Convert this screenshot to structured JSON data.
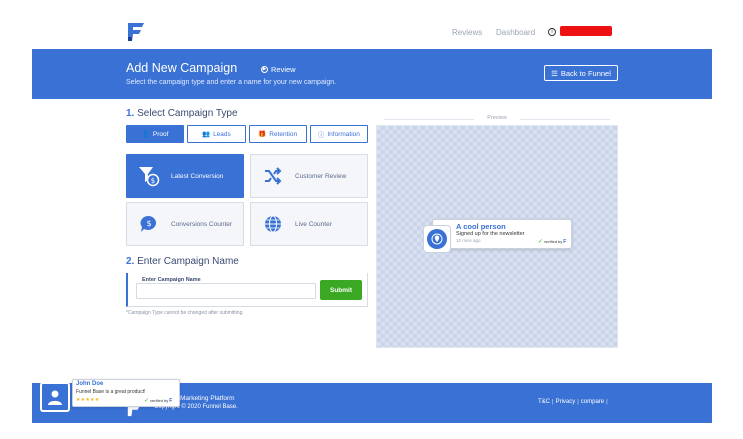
{
  "nav": {
    "reviews": "Reviews",
    "dashboard": "Dashboard",
    "info_icon": "info-icon"
  },
  "banner": {
    "title": "Add New Campaign",
    "review_label": "Review",
    "subtitle": "Select the campaign type and enter a name for your new campaign.",
    "back_button": "Back to Funnel"
  },
  "section1": {
    "num": "1.",
    "title": "Select Campaign Type"
  },
  "tabs": [
    {
      "label": "Proof",
      "icon": "user-plus-icon",
      "active": true
    },
    {
      "label": "Leads",
      "icon": "users-icon",
      "active": false
    },
    {
      "label": "Retention",
      "icon": "gift-icon",
      "active": false
    },
    {
      "label": "Information",
      "icon": "info-icon",
      "active": false
    }
  ],
  "types": [
    {
      "label": "Latest Conversion",
      "icon": "funnel-dollar-icon",
      "active": true
    },
    {
      "label": "Customer Review",
      "icon": "shuffle-icon",
      "active": false
    },
    {
      "label": "Conversions Counter",
      "icon": "dollar-bubble-icon",
      "active": false
    },
    {
      "label": "Live Counter",
      "icon": "globe-icon",
      "active": false
    }
  ],
  "section2": {
    "num": "2.",
    "title": "Enter Campaign Name"
  },
  "name_form": {
    "label": "Enter Campaign Name",
    "value": "",
    "submit": "Submit",
    "note": "*Campaign Type cannot be changed after submitting."
  },
  "preview": {
    "label": "Preview",
    "notification": {
      "name": "A cool person",
      "message": "Signed up for the newsletter",
      "time": "10 mins ago",
      "verified": "verified by"
    }
  },
  "footer": {
    "line1": "Marketing Platform",
    "line2": "Copyright © 2020 Funnel Base.",
    "links": [
      "T&C",
      "Privacy",
      "compare"
    ]
  },
  "popup": {
    "name": "John Doe",
    "message": "Funnel Base is a great product!",
    "stars": "★★★★★",
    "verified": "verified by"
  },
  "colors": {
    "accent": "#3a71d5",
    "submit": "#3aa823",
    "redacted": "#ee1111"
  }
}
